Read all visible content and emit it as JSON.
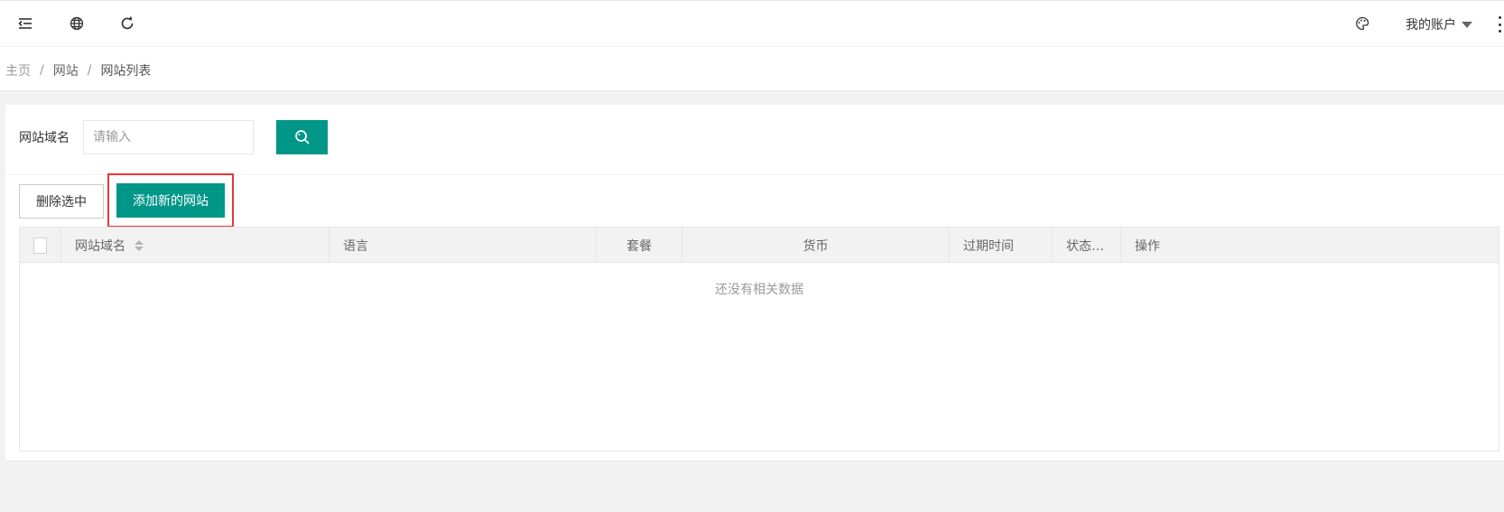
{
  "header": {
    "account_label": "我的账户",
    "icons": [
      "menu-fold-icon",
      "globe-icon",
      "refresh-icon",
      "palette-icon",
      "more-vertical-icon"
    ]
  },
  "breadcrumb": {
    "items": [
      "主页",
      "网站",
      "网站列表"
    ],
    "separator": "/"
  },
  "search": {
    "label": "网站域名",
    "placeholder": "请输入",
    "value": ""
  },
  "toolbar": {
    "delete_selected_label": "删除选中",
    "add_site_label": "添加新的网站"
  },
  "table": {
    "columns": [
      "网站域名",
      "语言",
      "套餐",
      "货币",
      "过期时间",
      "状态…",
      "操作"
    ],
    "empty_text": "还没有相关数据"
  },
  "colors": {
    "primary": "#009688",
    "highlight": "#e53935",
    "header_bg": "#f2f2f2"
  }
}
